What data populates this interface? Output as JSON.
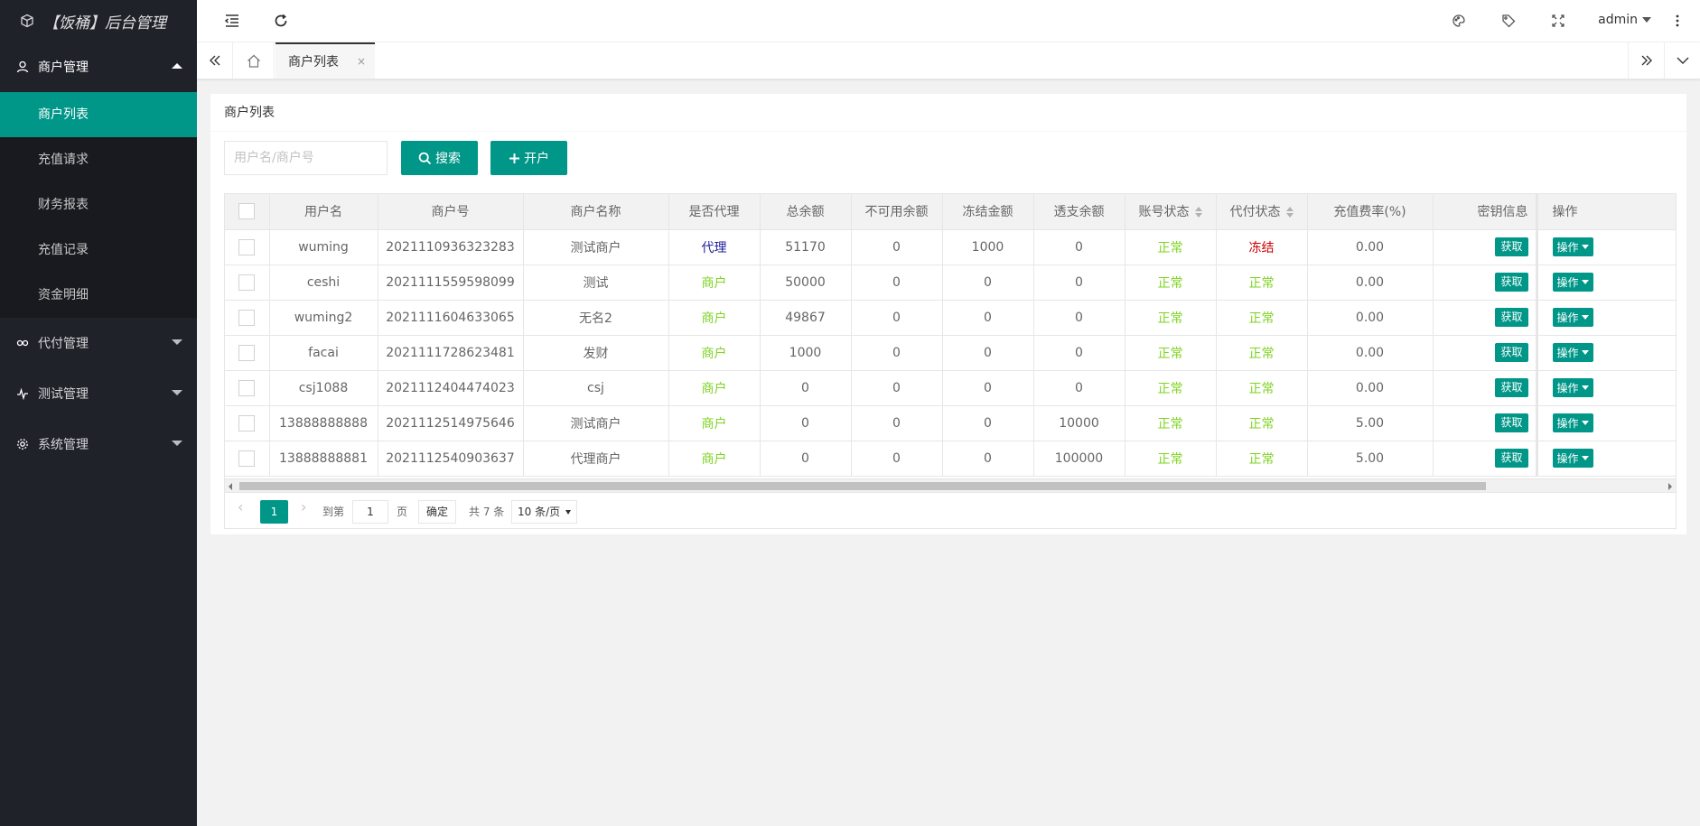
{
  "app": {
    "title": "【饭桶】后台管理"
  },
  "sidebar": {
    "groups": [
      {
        "label": "商户管理",
        "items": [
          "商户列表",
          "充值请求",
          "财务报表",
          "充值记录",
          "资金明细"
        ]
      },
      {
        "label": "代付管理"
      },
      {
        "label": "测试管理"
      },
      {
        "label": "系统管理"
      }
    ]
  },
  "header": {
    "user": "admin"
  },
  "tabs": {
    "active": "商户列表",
    "close": "×"
  },
  "card": {
    "title": "商户列表",
    "search_placeholder": "用户名/商户号",
    "search_label": "搜索",
    "open_label": "开户"
  },
  "table": {
    "columns": [
      "用户名",
      "商户号",
      "商户名称",
      "是否代理",
      "总余额",
      "不可用余额",
      "冻结金额",
      "透支余额",
      "账号状态",
      "代付状态",
      "充值费率(%)",
      "密钥信息",
      "操作"
    ],
    "get_label": "获取",
    "op_label": "操作",
    "rows": [
      [
        "wuming",
        "2021110936323283",
        "测试商户",
        "代理",
        "51170",
        "0",
        "1000",
        "0",
        "正常",
        "冻结",
        "0.00"
      ],
      [
        "ceshi",
        "2021111559598099",
        "测试",
        "商户",
        "50000",
        "0",
        "0",
        "0",
        "正常",
        "正常",
        "0.00"
      ],
      [
        "wuming2",
        "2021111604633065",
        "无名2",
        "商户",
        "49867",
        "0",
        "0",
        "0",
        "正常",
        "正常",
        "0.00"
      ],
      [
        "facai",
        "2021111728623481",
        "发财",
        "商户",
        "1000",
        "0",
        "0",
        "0",
        "正常",
        "正常",
        "0.00"
      ],
      [
        "csj1088",
        "2021112404474023",
        "csj",
        "商户",
        "0",
        "0",
        "0",
        "0",
        "正常",
        "正常",
        "0.00"
      ],
      [
        "13888888888",
        "2021112514975646",
        "测试商户",
        "商户",
        "0",
        "0",
        "0",
        "10000",
        "正常",
        "正常",
        "5.00"
      ],
      [
        "13888888881",
        "2021112540903637",
        "代理商户",
        "商户",
        "0",
        "0",
        "0",
        "100000",
        "正常",
        "正常",
        "5.00"
      ]
    ]
  },
  "pager": {
    "current": "1",
    "goto_label": "到第",
    "page_input": "1",
    "page_unit": "页",
    "ok_label": "确定",
    "total": "共 7 条",
    "per_page": "10 条/页"
  },
  "colors": {
    "accent": "#009688",
    "sidebar_bg": "#20222a"
  }
}
